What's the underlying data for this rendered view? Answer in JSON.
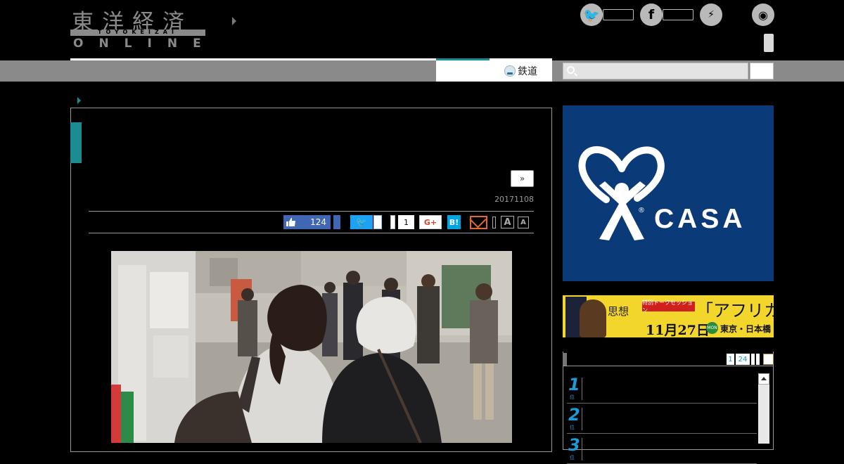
{
  "header": {
    "logo": {
      "kanji": "東洋経済",
      "roman": "TOYOKEIZAI",
      "online": "ONLINE"
    },
    "social": {
      "twitter_icon": "twitter-icon",
      "facebook_icon": "facebook-icon",
      "messenger_icon": "messenger-icon",
      "rss_icon": "rss-icon",
      "twitter_glyph": "🐦",
      "facebook_glyph": "f",
      "messenger_glyph": "⚡",
      "rss_glyph": "◉"
    }
  },
  "nav": {
    "rail_tab_label": "鉄道",
    "search_placeholder": ""
  },
  "article": {
    "next_label": "»",
    "date": "20171108",
    "share": {
      "like_count": "124",
      "tweet_label": "🐦",
      "pocket_count": "1",
      "gplus_label": "G+",
      "hatena_label": "B!",
      "font_large": "A",
      "font_small": "A"
    }
  },
  "sidebar": {
    "ad_casa": {
      "text": "CASA",
      "reg": "®"
    },
    "ad_africa": {
      "label": "特別トークセッション",
      "title": "「アフリカ」",
      "date": "11月27日",
      "day": "MON",
      "place": "東京・日本橋",
      "thought": "思想"
    },
    "ranking": {
      "tab_1": "1",
      "tab_24": "24",
      "tab_c": "1",
      "items": [
        {
          "num": "1",
          "sub": "位"
        },
        {
          "num": "2",
          "sub": "位"
        },
        {
          "num": "3",
          "sub": "位"
        }
      ]
    }
  },
  "colors": {
    "accent_teal": "#1a8c92",
    "nav_gray": "#8a8a8a",
    "facebook_blue": "#4267b2",
    "twitter_blue": "#1da1f2",
    "casa_blue": "#0b3a78",
    "africa_yellow": "#f3d62c"
  }
}
